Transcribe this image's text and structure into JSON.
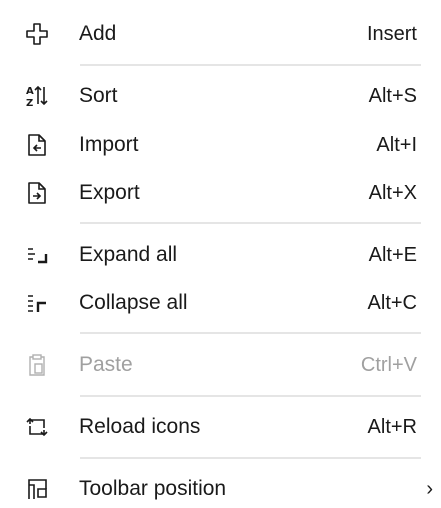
{
  "menu": {
    "items": [
      {
        "label": "Add",
        "shortcut": "Insert",
        "icon": "add-icon"
      },
      {
        "label": "Sort",
        "shortcut": "Alt+S",
        "icon": "sort-icon"
      },
      {
        "label": "Import",
        "shortcut": "Alt+I",
        "icon": "import-icon"
      },
      {
        "label": "Export",
        "shortcut": "Alt+X",
        "icon": "export-icon"
      },
      {
        "label": "Expand all",
        "shortcut": "Alt+E",
        "icon": "expand-all-icon"
      },
      {
        "label": "Collapse all",
        "shortcut": "Alt+C",
        "icon": "collapse-all-icon"
      },
      {
        "label": "Paste",
        "shortcut": "Ctrl+V",
        "icon": "paste-icon",
        "disabled": true
      },
      {
        "label": "Reload icons",
        "shortcut": "Alt+R",
        "icon": "reload-icons-icon"
      },
      {
        "label": "Toolbar position",
        "submenu_glyph": "›",
        "icon": "toolbar-position-icon"
      }
    ]
  },
  "colors": {
    "text": "#1a1a1a",
    "disabled_text": "#a0a0a0",
    "separator": "#e5e5e5",
    "background": "#ffffff"
  }
}
